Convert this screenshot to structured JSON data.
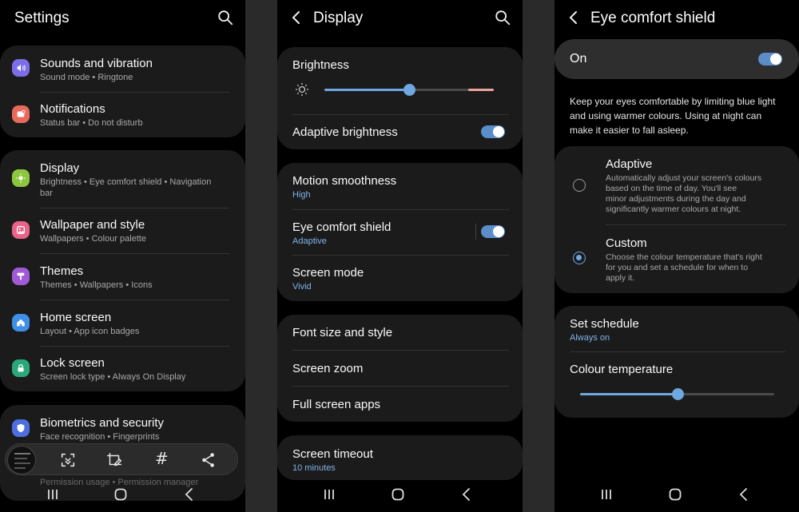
{
  "settings": {
    "title": "Settings",
    "groups": [
      [
        {
          "title": "Sounds and vibration",
          "sub": "Sound mode  •  Ringtone",
          "icon": "sound-icon",
          "color": "#7b6ee8"
        },
        {
          "title": "Notifications",
          "sub": "Status bar  •  Do not disturb",
          "icon": "notifications-icon",
          "color": "#e86a5d"
        }
      ],
      [
        {
          "title": "Display",
          "sub": "Brightness  •  Eye comfort shield  •  Navigation",
          "sub2": "bar",
          "icon": "display-icon",
          "color": "#8cc63f"
        },
        {
          "title": "Wallpaper and style",
          "sub": "Wallpapers  •  Colour palette",
          "icon": "wallpaper-icon",
          "color": "#e8628a"
        },
        {
          "title": "Themes",
          "sub": "Themes  •  Wallpapers  •  Icons",
          "icon": "themes-icon",
          "color": "#a05ad8"
        },
        {
          "title": "Home screen",
          "sub": "Layout  •  App icon badges",
          "icon": "home-screen-icon",
          "color": "#3f8ee8"
        },
        {
          "title": "Lock screen",
          "sub": "Screen lock type  •  Always On Display",
          "icon": "lock-icon",
          "color": "#2aa87a"
        }
      ],
      [
        {
          "title": "Biometrics and security",
          "sub": "Face recognition  •  Fingerprints",
          "icon": "shield-icon",
          "color": "#4d6ee0"
        }
      ]
    ],
    "partial_sub": "Permission usage  •  Permission manager"
  },
  "display": {
    "title": "Display",
    "brightness_label": "Brightness",
    "brightness_level": 0.5,
    "adaptive_brightness_label": "Adaptive brightness",
    "motion_smoothness": {
      "title": "Motion smoothness",
      "value": "High"
    },
    "eye_comfort": {
      "title": "Eye comfort shield",
      "value": "Adaptive"
    },
    "screen_mode": {
      "title": "Screen mode",
      "value": "Vivid"
    },
    "font_size": "Font size and style",
    "screen_zoom": "Screen zoom",
    "full_screen_apps": "Full screen apps",
    "screen_timeout": {
      "title": "Screen timeout",
      "value": "10 minutes"
    }
  },
  "eye": {
    "title": "Eye comfort shield",
    "on_label": "On",
    "description": [
      "Keep your eyes comfortable by limiting blue light",
      "and using warmer colours. Using at night can",
      "make it easier to fall asleep."
    ],
    "adaptive": {
      "title": "Adaptive",
      "lines": [
        "Automatically adjust your screen's colours",
        "based on the time of day. You'll see",
        "minor adjustments during the day and",
        "significantly warmer colours at night."
      ]
    },
    "custom": {
      "title": "Custom",
      "lines": [
        "Choose the colour temperature that's right",
        "for you and set a schedule for when to",
        "apply it."
      ]
    },
    "schedule": {
      "title": "Set schedule",
      "value": "Always on"
    },
    "colour_temperature_label": "Colour temperature",
    "colour_temperature_level": 0.5
  },
  "colors": {
    "accent": "#6fa7e0",
    "card": "#1b1b1b",
    "background": "#000000"
  }
}
